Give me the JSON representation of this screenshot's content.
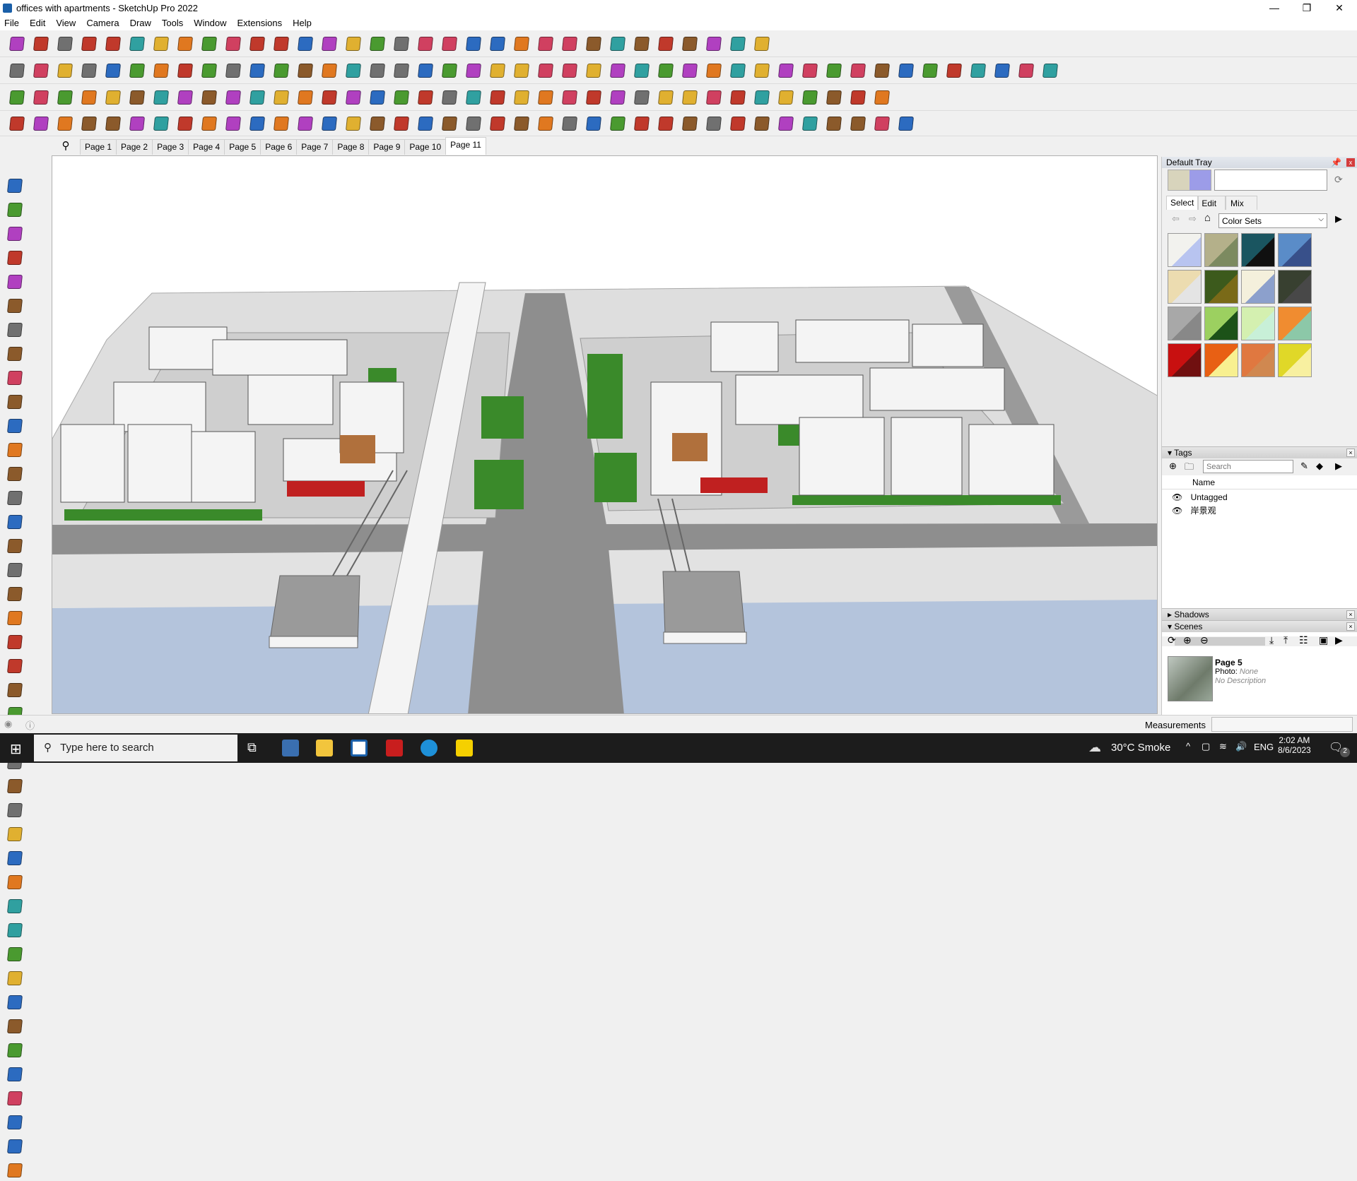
{
  "window": {
    "title": "offices with apartments - SketchUp Pro 2022",
    "minimize": "—",
    "restore": "❐",
    "close": "✕"
  },
  "menu": [
    "File",
    "Edit",
    "View",
    "Camera",
    "Draw",
    "Tools",
    "Window",
    "Extensions",
    "Help"
  ],
  "toolbars": {
    "row1": [
      "search-zoom-icon",
      "select-arrow-icon",
      "eraser-icon",
      "pencil-icon",
      "arc-icon",
      "rectangle-icon",
      "push-pull-icon",
      "follow-me-icon",
      "move-icon",
      "rotate-icon",
      "scale-icon",
      "tape-measure-icon",
      "text-label-icon",
      "paint-bucket-icon",
      "orbit-icon",
      "pan-icon",
      "zoom-icon",
      "zoom-extents-icon",
      "warehouse-icon",
      "extension-icon",
      "layers-icon",
      "profile-icon",
      "section-icon",
      "axes-icon",
      "sandbox-icon",
      "arrows-up-icon",
      "arrows-down-icon",
      "tool-icon",
      "x-ray-icon",
      "undo-icon",
      "redo-icon",
      "hand-icon"
    ],
    "row2": [
      "style-yellow-icon",
      "style-blue-icon",
      "style-green-icon",
      "pushpull-down-icon",
      "pushpull-black-icon",
      "pushpull-blue-icon",
      "pushpull-red-icon",
      "pushpull-green-icon",
      "pushpull-brown-icon",
      "pushpull-orange-icon",
      "pushpull-magenta-icon",
      "curve-icon",
      "section-plane-icon",
      "section-cut-icon",
      "section-fill-icon",
      "terrain-icon",
      "mesh-icon",
      "house-icon",
      "door-icon",
      "home-icon",
      "outline-icon",
      "roof-icon",
      "formula-icon",
      "leaf-icon",
      "knife-icon",
      "square-icon",
      "circle-icon",
      "polygon-icon",
      "ellipse-icon",
      "parallelogram-icon",
      "arc2-icon",
      "gear-icon",
      "ruler-icon",
      "path-icon",
      "target-icon",
      "line-red-icon",
      "eraser-pink-icon",
      "solid-icon",
      "grid-icon",
      "cube-red-icon",
      "tent-icon",
      "box-icon",
      "flatten-icon",
      "stamp-icon"
    ],
    "row3": [
      "material-icon",
      "plane-blue-icon",
      "plane-yellow-icon",
      "plane-green-icon",
      "brick-icon",
      "tile-icon",
      "spiral-icon",
      "window-red-icon",
      "panel-icon",
      "flag-icon",
      "wood-icon",
      "pipe-icon",
      "bend-icon",
      "points-icon",
      "cross-red-icon",
      "cross-green-icon",
      "cross-blue-icon",
      "drop-icon",
      "drop-num-icon",
      "warning-icon",
      "lasso-icon",
      "weld-icon",
      "loop-icon",
      "star-icon",
      "cup-icon",
      "magnet-icon",
      "tree-icon",
      "bucket-icon",
      "cut-icon",
      "move3d-icon",
      "stack-icon",
      "grid-orange-icon",
      "grid-yellow-icon",
      "grid-gold-icon",
      "scatter-icon",
      "curve-dots-icon",
      "qr-icon"
    ],
    "row4": [
      "paper-icon",
      "polyline-icon",
      "fold-icon",
      "cross-line-icon",
      "octagon-icon",
      "offset-icon",
      "ribbon-icon",
      "dome-icon",
      "sphere-icon",
      "cube-icon",
      "fillet-icon",
      "chamfer-icon",
      "angle-icon",
      "extrude-icon",
      "frame-icon",
      "loft-icon",
      "columns-icon",
      "array-icon",
      "hand2-icon",
      "leaf2-icon",
      "sweep-icon",
      "stairs-icon",
      "ramp-icon",
      "fan-icon",
      "rail-icon",
      "bus-icon",
      "pattern-icon",
      "wall-icon",
      "door2-icon",
      "floor-icon",
      "grid2-icon",
      "stack2-icon",
      "fence-icon",
      "star2-icon",
      "diamond-icon",
      "comb-icon",
      "plant-icon",
      "shell-icon"
    ]
  },
  "left_tools": [
    "select-icon",
    "orbit-icon",
    "paint-icon",
    "eraser-icon",
    "component-icon",
    "tape-icon",
    "line-icon",
    "freehand-icon",
    "rectangle-icon",
    "rotated-rect-icon",
    "circle-icon",
    "polygon-icon",
    "arc-icon",
    "pie-icon",
    "arc3-icon",
    "pie2-icon",
    "move-icon",
    "pushpull-icon",
    "rotate-icon",
    "followme-icon",
    "scale-icon",
    "offset-icon",
    "tape-measure-icon",
    "dimension-icon",
    "protractor-icon",
    "text-icon",
    "axes-icon",
    "3dtext-icon",
    "orbit-active-icon",
    "pan-icon",
    "zoom-icon",
    "zoom-window-icon",
    "zoom-extents-icon",
    "previous-icon",
    "walk-icon",
    "look-icon",
    "footprints-icon",
    "position-camera-icon",
    "warehouse-icon",
    "extension-icon",
    "layers-icon",
    "profile-icon"
  ],
  "scene_tabs": [
    "Page 1",
    "Page 2",
    "Page 3",
    "Page 4",
    "Page 5",
    "Page 6",
    "Page 7",
    "Page 8",
    "Page 9",
    "Page 10",
    "Page 11"
  ],
  "active_scene_tab": "Page 11",
  "tray": {
    "title": "Default Tray",
    "materials": {
      "tabs": [
        "Select",
        "Edit",
        "Mix"
      ],
      "dropdown": "Color Sets",
      "swatches": [
        [
          "#f2f2ee",
          "#b8c4f0"
        ],
        [
          "#b4b08a",
          "#7c8a60"
        ],
        [
          "#1a5560",
          "#101010"
        ],
        [
          "#5a8cc8",
          "#38508a"
        ],
        [
          "#ecdcb0",
          "#e4e4e4"
        ],
        [
          "#3c5a1c",
          "#7a6a18"
        ],
        [
          "#f4f0dc",
          "#8ca0cc"
        ],
        [
          "#384030",
          "#484848"
        ],
        [
          "#a8a8a8",
          "#888888"
        ],
        [
          "#9cd060",
          "#1c5218"
        ],
        [
          "#d4f0b0",
          "#c8f0d8"
        ],
        [
          "#f08c30",
          "#8cc8a8"
        ],
        [
          "#c81010",
          "#701010"
        ],
        [
          "#e86014",
          "#f8f090"
        ],
        [
          "#e07840",
          "#d08850"
        ],
        [
          "#e0d828",
          "#f8f0a0"
        ]
      ]
    },
    "tags": {
      "title": "Tags",
      "search_placeholder": "Search",
      "column": "Name",
      "items": [
        "Untagged",
        "岸景观"
      ]
    },
    "shadows": {
      "title": "Shadows"
    },
    "scenes": {
      "title": "Scenes",
      "item": {
        "name": "Page 5",
        "photo_label": "Photo:",
        "photo_value": "None",
        "description": "No Description"
      }
    }
  },
  "status": {
    "measurements_label": "Measurements",
    "measurements_value": ""
  },
  "taskbar": {
    "search_placeholder": "Type here to search",
    "weather": "30°C  Smoke",
    "language": "ENG",
    "time": "2:02 AM",
    "date": "8/6/2023",
    "notifications": "2"
  },
  "colors": {
    "accent": "#1a5fa8",
    "water": "#b4c4dc",
    "road": "#8e8e8e",
    "lawn": "#3a8a2a"
  }
}
